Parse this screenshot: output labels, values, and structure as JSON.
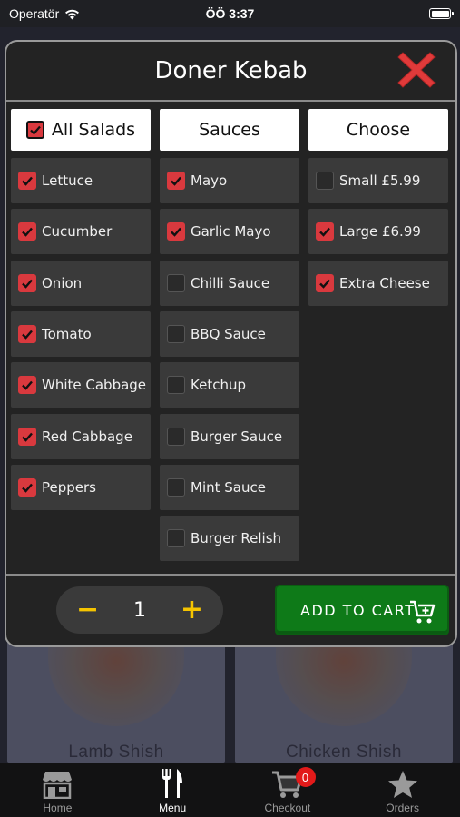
{
  "status_bar": {
    "carrier": "Operatör",
    "time": "ÖÖ 3:37"
  },
  "background": {
    "cards": [
      {
        "label": "Lamb Shish"
      },
      {
        "label": "Chicken Shish"
      }
    ]
  },
  "modal": {
    "title": "Doner Kebab",
    "columns": [
      {
        "header": "All Salads",
        "header_checked": true,
        "options": [
          {
            "label": "Lettuce",
            "checked": true
          },
          {
            "label": "Cucumber",
            "checked": true
          },
          {
            "label": "Onion",
            "checked": true
          },
          {
            "label": "Tomato",
            "checked": true
          },
          {
            "label": "White Cabbage",
            "checked": true
          },
          {
            "label": "Red Cabbage",
            "checked": true
          },
          {
            "label": "Peppers",
            "checked": true
          }
        ]
      },
      {
        "header": "Sauces",
        "options": [
          {
            "label": "Mayo",
            "checked": true
          },
          {
            "label": "Garlic Mayo",
            "checked": true
          },
          {
            "label": "Chilli Sauce",
            "checked": false
          },
          {
            "label": "BBQ Sauce",
            "checked": false
          },
          {
            "label": "Ketchup",
            "checked": false
          },
          {
            "label": "Burger Sauce",
            "checked": false
          },
          {
            "label": "Mint Sauce",
            "checked": false
          },
          {
            "label": "Burger Relish",
            "checked": false
          }
        ]
      },
      {
        "header": "Choose",
        "options": [
          {
            "label": "Small £5.99",
            "checked": false
          },
          {
            "label": "Large £6.99",
            "checked": true
          },
          {
            "label": "Extra Cheese",
            "checked": true
          }
        ]
      }
    ],
    "quantity": {
      "minus": "−",
      "value": "1",
      "plus": "+"
    },
    "add_to_cart": "ADD TO CART"
  },
  "tab_bar": {
    "tabs": [
      {
        "label": "Home",
        "icon": "store-icon",
        "active": false
      },
      {
        "label": "Menu",
        "icon": "fork-knife-icon",
        "active": true
      },
      {
        "label": "Checkout",
        "icon": "cart-icon",
        "active": false,
        "badge": "0"
      },
      {
        "label": "Orders",
        "icon": "star-icon",
        "active": false
      }
    ]
  },
  "colors": {
    "accent_red": "#d9393e",
    "cart_green": "#0e7a18",
    "qty_yellow": "#f5c400"
  }
}
